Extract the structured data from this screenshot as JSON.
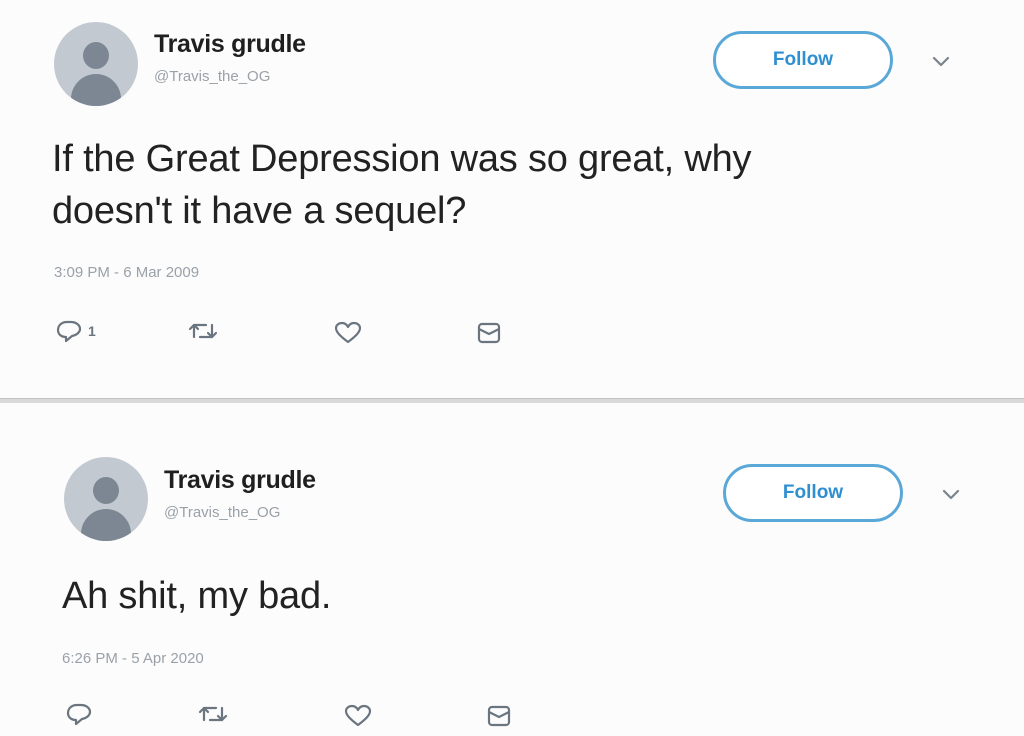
{
  "tweets": [
    {
      "author_name": "Travis grudle",
      "author_handle": "@Travis_the_OG",
      "follow_label": "Follow",
      "text_line_1": "If the Great Depression was so great, why",
      "text_line_2": "doesn't it have a sequel?",
      "timestamp": "3:09 PM - 6 Mar 2009",
      "reply_count": "1",
      "icons": [
        "avatar",
        "chevron-down-icon",
        "reply-icon",
        "retweet-icon",
        "like-icon",
        "message-icon"
      ]
    },
    {
      "author_name": "Travis grudle",
      "author_handle": "@Travis_the_OG",
      "follow_label": "Follow",
      "text_line_1": "Ah shit, my bad.",
      "timestamp": "6:26 PM - 5 Apr 2020",
      "reply_count": "",
      "icons": [
        "avatar",
        "chevron-down-icon",
        "reply-icon",
        "retweet-icon",
        "like-icon",
        "message-icon"
      ]
    }
  ],
  "colors": {
    "follow_border": "#5aa8d8",
    "follow_text": "#2f8fd0",
    "text": "#222222",
    "muted": "#9aa1a8",
    "icon": "#6b7580"
  }
}
